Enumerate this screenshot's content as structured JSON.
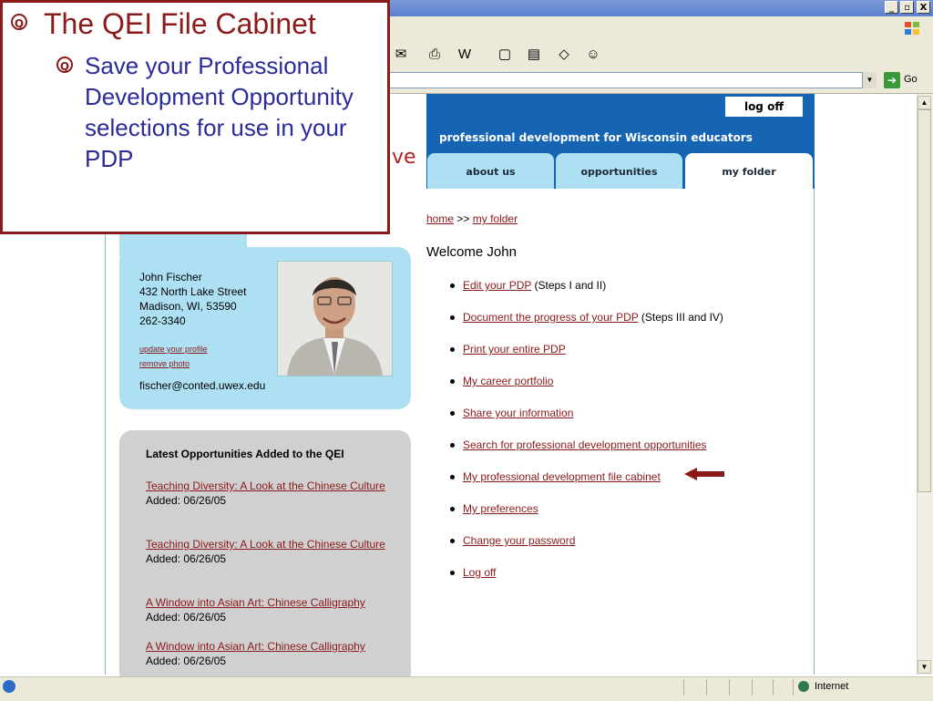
{
  "window": {
    "minimize": "_",
    "restore": "▫",
    "close": "X"
  },
  "address": {
    "go_label": "Go"
  },
  "site": {
    "logoff_label": "log off",
    "tagline": "professional development for Wisconsin educators",
    "brand_fragment": "ve",
    "tabs": [
      {
        "label": "about us"
      },
      {
        "label": "opportunities"
      },
      {
        "label": "my folder"
      }
    ]
  },
  "breadcrumb": {
    "home": "home",
    "sep": ">>",
    "current": "my folder"
  },
  "welcome": "Welcome John",
  "menu": [
    {
      "link": "Edit your PDP",
      "suffix": "(Steps I and II)"
    },
    {
      "link": "Document the progress of your PDP",
      "suffix": "(Steps III and IV)"
    },
    {
      "link": "Print your entire PDP",
      "suffix": ""
    },
    {
      "link": "My career portfolio",
      "suffix": ""
    },
    {
      "link": "Share your information",
      "suffix": ""
    },
    {
      "link": "Search for professional development opportunities",
      "suffix": ""
    },
    {
      "link": "My professional development file cabinet",
      "suffix": ""
    },
    {
      "link": "My preferences",
      "suffix": ""
    },
    {
      "link": "Change your password",
      "suffix": ""
    },
    {
      "link": "Log off",
      "suffix": ""
    }
  ],
  "profile": {
    "name": "John Fischer",
    "street": "432 North Lake Street",
    "city": "Madison, WI, 53590",
    "phone": "262-3340",
    "update_link": "update your profile",
    "remove_link": "remove photo",
    "email": "fischer@conted.uwex.edu"
  },
  "latest": {
    "title": "Latest Opportunities Added to the QEI",
    "items": [
      {
        "title": "Teaching Diversity: A Look at the Chinese Culture",
        "added": "Added: 06/26/05"
      },
      {
        "title": "Teaching Diversity: A Look at the Chinese Culture",
        "added": "Added: 06/26/05"
      },
      {
        "title": "A Window into Asian Art: Chinese Calligraphy",
        "added": "Added: 06/26/05"
      },
      {
        "title": "A Window into Asian Art: Chinese Calligraphy",
        "added": "Added: 06/26/05"
      }
    ]
  },
  "status": {
    "zone": "Internet"
  },
  "callout": {
    "title": "The QEI File Cabinet",
    "body": "Save your Professional Development Opportunity selections for use in your PDP",
    "bullet_glyph": "Q"
  },
  "colors": {
    "accent_red": "#8b1a1a",
    "banner_blue": "#1565b4",
    "light_blue": "#aee0f4",
    "callout_text": "#2b2b9a"
  }
}
